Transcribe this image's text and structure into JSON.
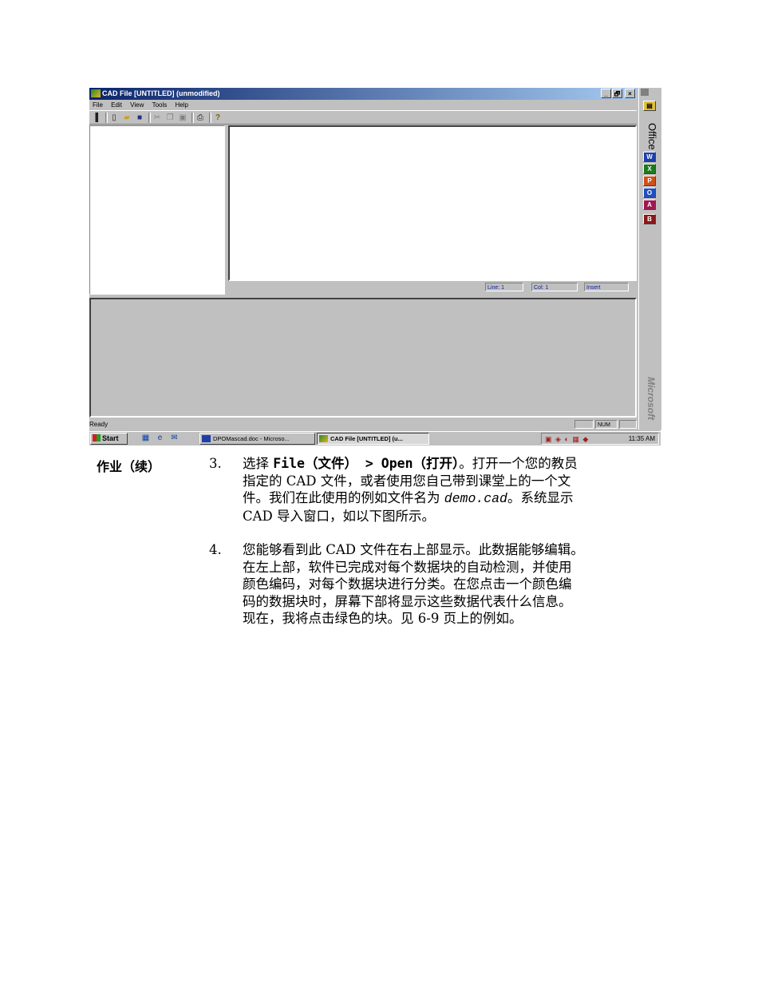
{
  "window": {
    "title": "CAD File [UNTITLED] (unmodified)",
    "controls": [
      "_",
      "🗗",
      "×"
    ]
  },
  "menu": [
    "File",
    "Edit",
    "View",
    "Tools",
    "Help"
  ],
  "toolbar": {
    "icons": [
      "toolbar-handle-icon",
      "new-file-icon",
      "open-folder-icon",
      "save-icon",
      "cut-icon",
      "copy-icon",
      "paste-icon",
      "print-icon",
      "help-icon"
    ]
  },
  "editor_status": {
    "line": "Line: 1",
    "col": "Col: 1",
    "mode": "Insert"
  },
  "statusbar": {
    "ready": "Ready",
    "num": "NUM"
  },
  "office_bar": {
    "label": "Office",
    "brand": "Microsoft",
    "apps": [
      {
        "name": "word-icon",
        "glyph": "W",
        "color": "#1f3fa8"
      },
      {
        "name": "excel-icon",
        "glyph": "X",
        "color": "#1d7a1d"
      },
      {
        "name": "powerpoint-icon",
        "glyph": "P",
        "color": "#d0501a"
      },
      {
        "name": "outlook-icon",
        "glyph": "O",
        "color": "#2050c0"
      },
      {
        "name": "access-icon",
        "glyph": "A",
        "color": "#a01850"
      },
      {
        "name": "binder-icon",
        "glyph": "B",
        "color": "#8a1a1a"
      }
    ]
  },
  "taskbar": {
    "start": "Start",
    "tasks": [
      {
        "label": "DPOMascad.doc - Microso...",
        "active": false
      },
      {
        "label": "CAD File [UNTITLED] (u...",
        "active": true
      }
    ],
    "clock": "11:35 AM"
  },
  "doc": {
    "side_label": "作业（续）",
    "steps": [
      {
        "number": "3.",
        "lines": [
          {
            "parts": [
              {
                "t": "选择 ",
                "style": "normal"
              },
              {
                "t": "File（文件） > Open（打开）",
                "style": "mono"
              },
              {
                "t": "。打开一个您的教员",
                "style": "normal"
              }
            ]
          },
          {
            "parts": [
              {
                "t": "指定的 CAD 文件，或者使用您自己带到课堂上的一个文",
                "style": "normal"
              }
            ]
          },
          {
            "parts": [
              {
                "t": "件。我们在此使用的例如文件名为 ",
                "style": "normal"
              },
              {
                "t": "demo.cad",
                "style": "ital"
              },
              {
                "t": "。系统显示",
                "style": "normal"
              }
            ]
          },
          {
            "parts": [
              {
                "t": "CAD 导入窗口，如以下图所示。",
                "style": "normal"
              }
            ]
          }
        ]
      },
      {
        "number": "4.",
        "lines": [
          {
            "parts": [
              {
                "t": "您能够看到此 CAD 文件在右上部显示。此数据能够编辑。",
                "style": "normal"
              }
            ]
          },
          {
            "parts": [
              {
                "t": "在左上部，软件已完成对每个数据块的自动检测，并使用",
                "style": "normal"
              }
            ]
          },
          {
            "parts": [
              {
                "t": "颜色编码，对每个数据块进行分类。在您点击一个颜色编",
                "style": "normal"
              }
            ]
          },
          {
            "parts": [
              {
                "t": "码的数据块时，屏幕下部将显示这些数据代表什么信息。",
                "style": "normal"
              }
            ]
          },
          {
            "parts": [
              {
                "t": "现在，我将点击绿色的块。见 6-9 页上的例如。",
                "style": "normal"
              }
            ]
          }
        ]
      }
    ]
  }
}
